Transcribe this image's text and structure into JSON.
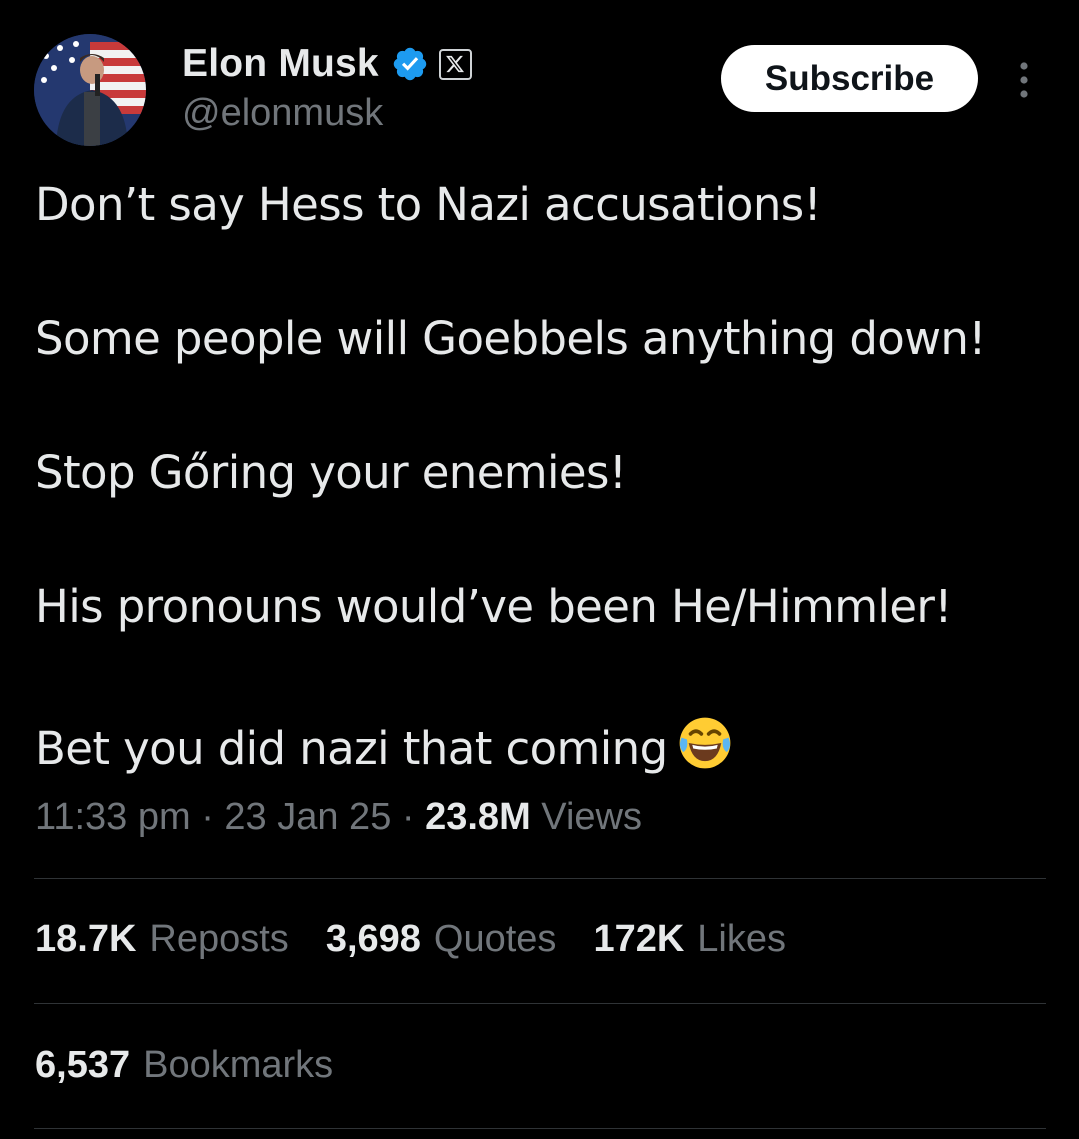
{
  "author": {
    "display_name": "Elon Musk",
    "handle": "@elonmusk",
    "avatar_icon": "profile-photo-with-us-flag",
    "verified_color": "#1d9bf0"
  },
  "actions": {
    "subscribe_label": "Subscribe",
    "more_icon": "more-vertical-icon"
  },
  "tweet": {
    "lines": [
      "Don’t say Hess to Nazi accusations!",
      "Some people will Goebbels anything down!",
      "Stop Gőring your enemies!",
      "His pronouns would’ve been He/Himmler!",
      "Bet you did nazi that coming"
    ],
    "emoji": "face-with-tears-of-joy"
  },
  "meta": {
    "time": "11:33 pm",
    "separator": "·",
    "date": "23 Jan 25",
    "views_count": "23.8M",
    "views_label": "Views"
  },
  "stats": {
    "reposts_count": "18.7K",
    "reposts_label": "Reposts",
    "quotes_count": "3,698",
    "quotes_label": "Quotes",
    "likes_count": "172K",
    "likes_label": "Likes",
    "bookmarks_count": "6,537",
    "bookmarks_label": "Bookmarks"
  },
  "colors": {
    "background": "#000000",
    "primary_text": "#e7e9ea",
    "secondary_text": "#71767b",
    "divider": "#2f3336"
  }
}
